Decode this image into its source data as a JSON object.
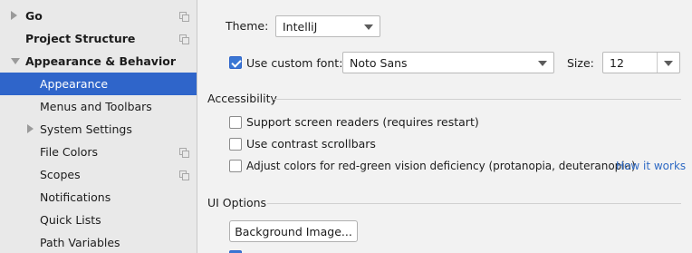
{
  "sidebar": {
    "items": [
      {
        "label": "Go"
      },
      {
        "label": "Project Structure"
      },
      {
        "label": "Appearance & Behavior"
      },
      {
        "label": "Appearance"
      },
      {
        "label": "Menus and Toolbars"
      },
      {
        "label": "System Settings"
      },
      {
        "label": "File Colors"
      },
      {
        "label": "Scopes"
      },
      {
        "label": "Notifications"
      },
      {
        "label": "Quick Lists"
      },
      {
        "label": "Path Variables"
      }
    ]
  },
  "appearance": {
    "theme_label": "Theme:",
    "theme_value": "IntelliJ",
    "custom_font_label": "Use custom font:",
    "font_value": "Noto Sans",
    "size_label": "Size:",
    "size_value": "12"
  },
  "accessibility": {
    "title": "Accessibility",
    "screen_readers_label": "Support screen readers (requires restart)",
    "contrast_scrollbars_label": "Use contrast scrollbars",
    "color_deficiency_label": "Adjust colors for red-green vision deficiency (protanopia, deuteranopia)",
    "how_it_works_link": "How it works"
  },
  "ui_options": {
    "title": "UI Options",
    "background_image_button": "Background Image..."
  },
  "colors": {
    "selection": "#2f65ca",
    "link": "#2f6ac4",
    "checkbox_checked": "#3a77d4"
  }
}
